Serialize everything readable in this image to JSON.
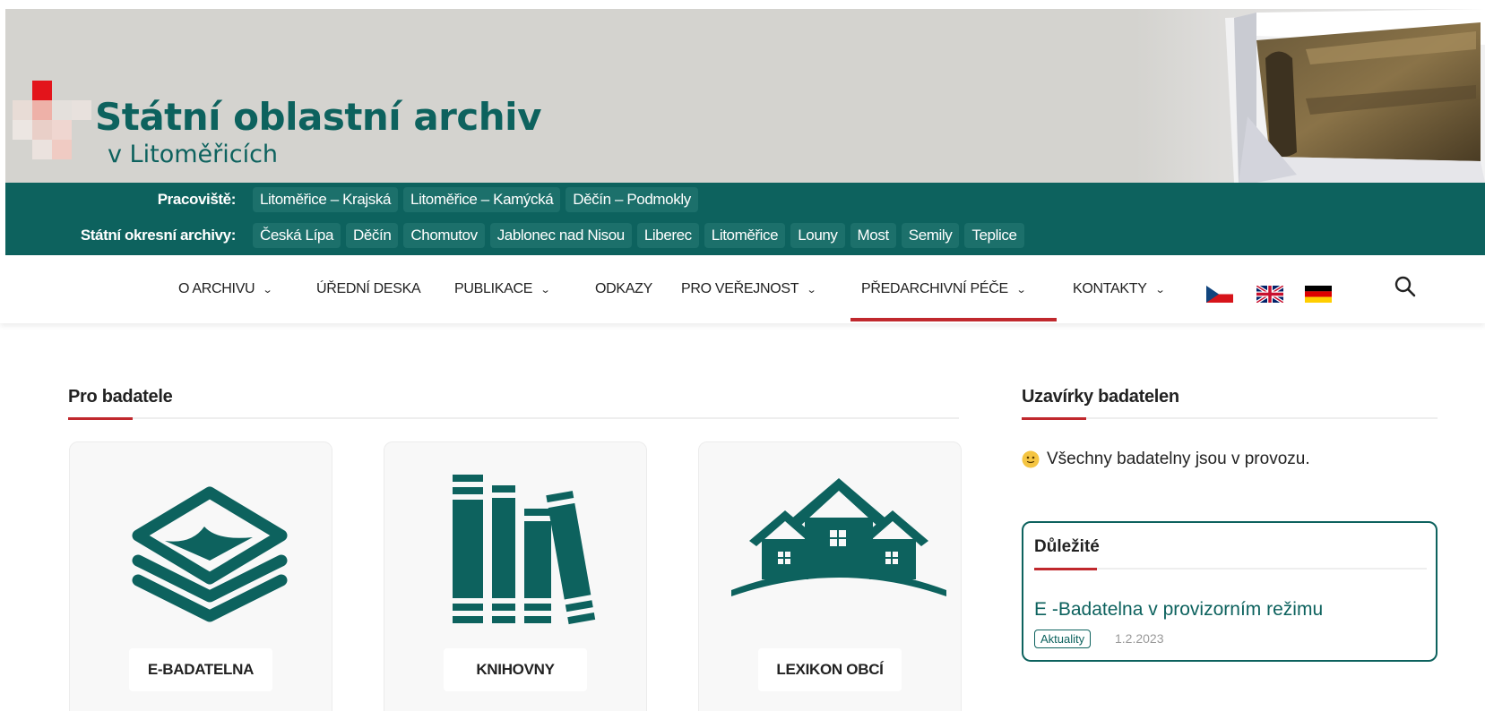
{
  "header": {
    "title": "Státní oblastní archiv",
    "subtitle": "v Litoměřicích"
  },
  "workplaces": {
    "label": "Pracoviště:",
    "items": [
      "Litoměřice – Krajská",
      "Litoměřice – Kamýcká",
      "Děčín – Podmokly"
    ]
  },
  "district_archives": {
    "label": "Státní okresní archivy:",
    "items": [
      "Česká Lípa",
      "Děčín",
      "Chomutov",
      "Jablonec nad Nisou",
      "Liberec",
      "Litoměřice",
      "Louny",
      "Most",
      "Semily",
      "Teplice"
    ]
  },
  "nav": {
    "items": [
      {
        "label": "O ARCHIVU",
        "dropdown": true
      },
      {
        "label": "ÚŘEDNÍ DESKA",
        "dropdown": false
      },
      {
        "label": "PUBLIKACE",
        "dropdown": true
      },
      {
        "label": "ODKAZY",
        "dropdown": false
      },
      {
        "label": "PRO VEŘEJNOST",
        "dropdown": true
      },
      {
        "label": "PŘEDARCHIVNÍ PÉČE",
        "dropdown": true,
        "active": true
      },
      {
        "label": "KONTAKTY",
        "dropdown": true
      }
    ],
    "caret": "⌄",
    "flags": [
      "czech-flag-icon",
      "uk-flag-icon",
      "german-flag-icon"
    ]
  },
  "researchers": {
    "title": "Pro badatele",
    "cards": [
      {
        "label": "E-BADATELNA",
        "icon": "layers-icon"
      },
      {
        "label": "KNIHOVNY",
        "icon": "books-icon"
      },
      {
        "label": "LEXIKON OBCÍ",
        "icon": "houses-icon"
      }
    ]
  },
  "closures": {
    "title": "Uzavírky badatelen",
    "status": "Všechny badatelny jsou v provozu."
  },
  "important": {
    "title": "Důležité",
    "news_title": "E -Badatelna v provizorním režimu",
    "tag": "Aktuality",
    "date": "1.2.2023"
  },
  "colors": {
    "teal": "#0d625e",
    "accent_red": "#c0282d",
    "header_bg": "#d4d3cf"
  }
}
